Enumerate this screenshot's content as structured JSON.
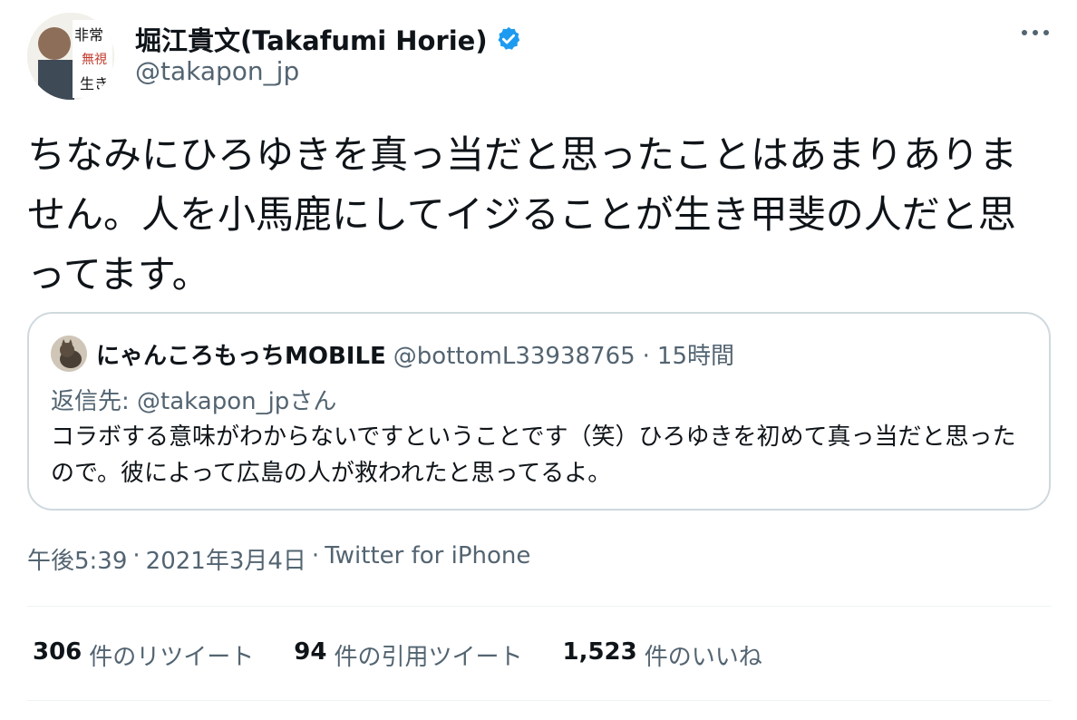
{
  "tweet": {
    "author": {
      "name": "堀江貴文(Takafumi Horie)",
      "handle": "@takapon_jp",
      "avatar_icon": "profile-photo"
    },
    "text": "ちなみにひろゆきを真っ当だと思ったことはあまりありません。人を小馬鹿にしてイジることが生き甲斐の人だと思ってます。",
    "timestamp": "午後5:39",
    "date": "2021年3月4日",
    "source": "Twitter for iPhone",
    "separator": "·"
  },
  "quote": {
    "author_name": "にゃんころもっちMOBILE",
    "author_handle": "@bottomL33938765",
    "separator": "·",
    "time": "15時間",
    "reply_prefix": "返信先: ",
    "reply_handle": "@takapon_jp",
    "reply_suffix": "さん",
    "text": "コラボする意味がわからないですということです（笑）ひろゆきを初めて真っ当だと思ったので。彼によって広島の人が救われたと思ってるよ。"
  },
  "stats": {
    "retweets": {
      "count": "306",
      "label": "件のリツイート"
    },
    "quotes": {
      "count": "94",
      "label": "件の引用ツイート"
    },
    "likes": {
      "count": "1,523",
      "label": "件のいいね"
    }
  },
  "colors": {
    "verified": "#1d9bf0",
    "secondary_text": "#536471",
    "border": "#cfd9de"
  },
  "icons": {
    "verified": "verified-badge-icon",
    "more": "more-horizontal-icon"
  }
}
